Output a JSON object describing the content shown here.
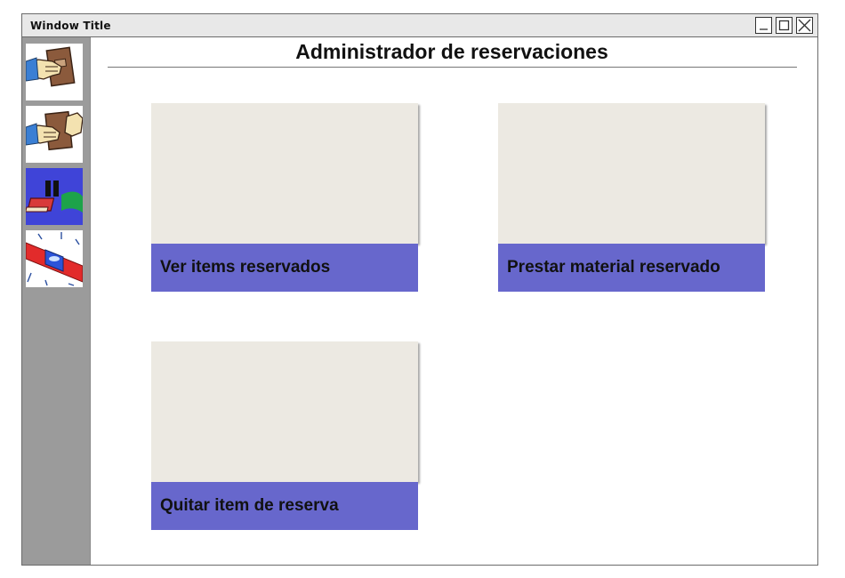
{
  "window": {
    "title": "Window Title",
    "controls": [
      {
        "name": "minimize-icon"
      },
      {
        "name": "maximize-icon"
      },
      {
        "name": "close-icon"
      }
    ]
  },
  "sidebar": {
    "items": [
      {
        "name": "sidebar-item-book-hand-icon"
      },
      {
        "name": "sidebar-item-book-handoff-icon"
      },
      {
        "name": "sidebar-item-pause-book-icon"
      },
      {
        "name": "sidebar-item-alert-light-icon"
      }
    ]
  },
  "main": {
    "page_title": "Administrador de reservaciones",
    "cards": [
      {
        "label": "Ver items reservados",
        "caption_color": "#6767cc"
      },
      {
        "label": "Prestar material reservado",
        "caption_color": "#6767cc"
      },
      {
        "label": "Quitar item de reserva",
        "caption_color": "#6767cc"
      }
    ]
  },
  "colors": {
    "titlebar": "#e8e8e8",
    "sidebar": "#9b9b9b",
    "card_media": "#ece9e2",
    "card_caption": "#6767cc"
  }
}
